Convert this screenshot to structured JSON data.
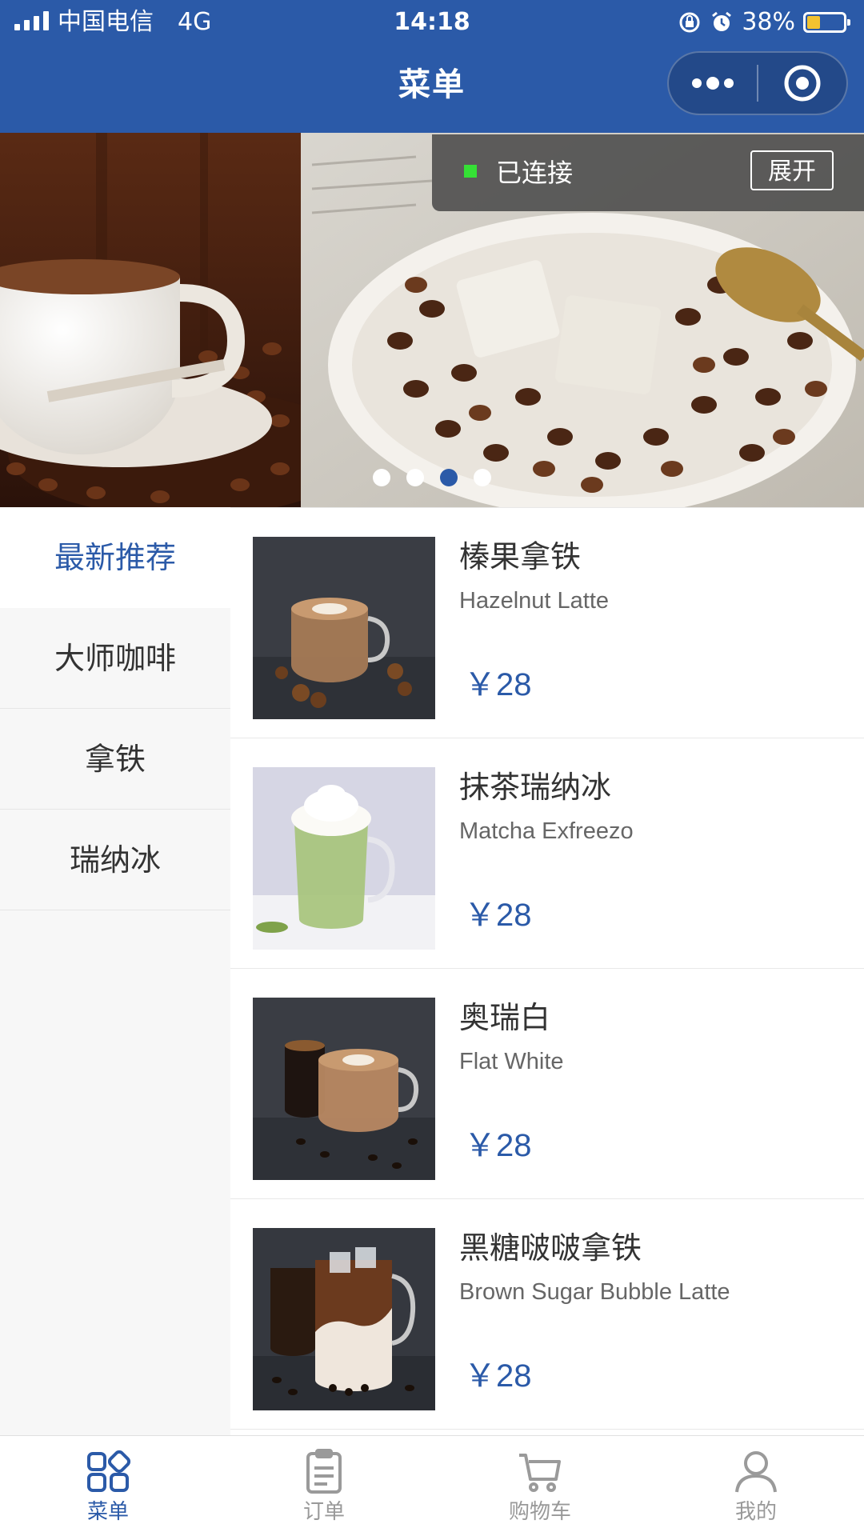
{
  "status_bar": {
    "carrier": "中国电信",
    "network": "4G",
    "time": "14:18",
    "battery": "38%",
    "battery_level": 0.38
  },
  "nav": {
    "title": "菜单"
  },
  "banner": {
    "slide_count": 4,
    "active_slide": 3,
    "connection": {
      "status": "已连接",
      "expand_label": "展开"
    }
  },
  "categories": [
    {
      "label": "最新推荐",
      "active": true
    },
    {
      "label": "大师咖啡",
      "active": false
    },
    {
      "label": "拿铁",
      "active": false
    },
    {
      "label": "瑞纳冰",
      "active": false
    }
  ],
  "products": [
    {
      "name_cn": "榛果拿铁",
      "name_en": "Hazelnut Latte",
      "price": "￥28"
    },
    {
      "name_cn": "抹茶瑞纳冰",
      "name_en": "Matcha Exfreezo",
      "price": "￥28"
    },
    {
      "name_cn": "奥瑞白",
      "name_en": "Flat White",
      "price": "￥28"
    },
    {
      "name_cn": "黑糖啵啵拿铁",
      "name_en": "Brown Sugar Bubble Latte",
      "price": "￥28"
    }
  ],
  "tabbar": {
    "items": [
      {
        "label": "菜单",
        "icon": "menu-grid-icon",
        "active": true
      },
      {
        "label": "订单",
        "icon": "order-clipboard-icon",
        "active": false
      },
      {
        "label": "购物车",
        "icon": "cart-icon",
        "active": false
      },
      {
        "label": "我的",
        "icon": "user-icon",
        "active": false
      }
    ]
  },
  "colors": {
    "brand": "#2b5aa8",
    "connected": "#35e035",
    "battery": "#f2c230"
  }
}
